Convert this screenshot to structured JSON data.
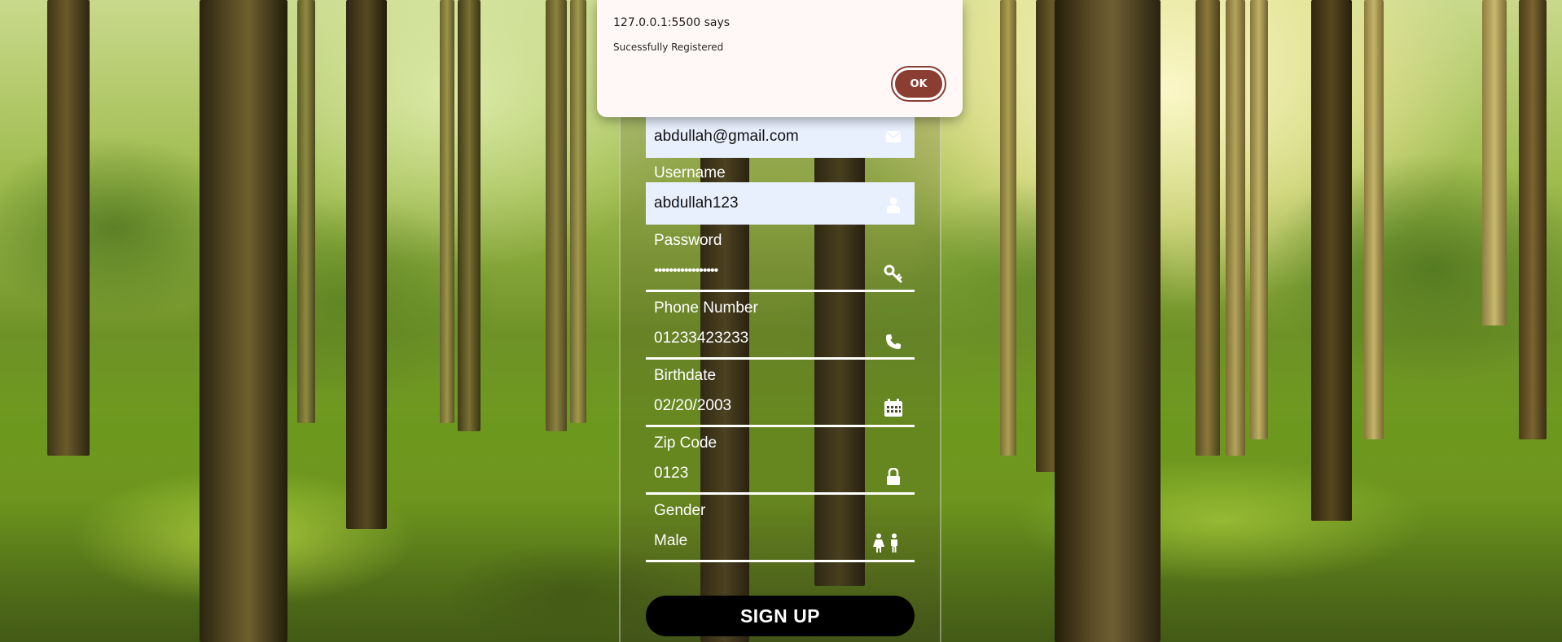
{
  "alert": {
    "origin": "127.0.0.1:5500 says",
    "message": "Sucessfully Registered",
    "ok_label": "OK"
  },
  "form": {
    "email": {
      "value": "abdullah@gmail.com",
      "icon": "envelope-icon"
    },
    "username": {
      "label": "Username",
      "value": "abdullah123",
      "icon": "user-icon"
    },
    "password": {
      "label": "Password",
      "value": "•••••••••••••••••",
      "icon": "key-icon"
    },
    "phone": {
      "label": "Phone Number",
      "value": "01233423233",
      "icon": "phone-icon"
    },
    "birthdate": {
      "label": "Birthdate",
      "value": "02/20/2003",
      "icon": "calendar-icon"
    },
    "zip": {
      "label": "Zip Code",
      "value": "0123",
      "icon": "lock-icon"
    },
    "gender": {
      "label": "Gender",
      "value": "Male",
      "icon": "male-female-icon"
    },
    "submit_label": "SIGN UP"
  },
  "colors": {
    "autofill_bg": "#e8f0fe",
    "alert_button": "#8a3d31",
    "alert_bg": "#fff8f7",
    "signup_button": "#000000"
  }
}
